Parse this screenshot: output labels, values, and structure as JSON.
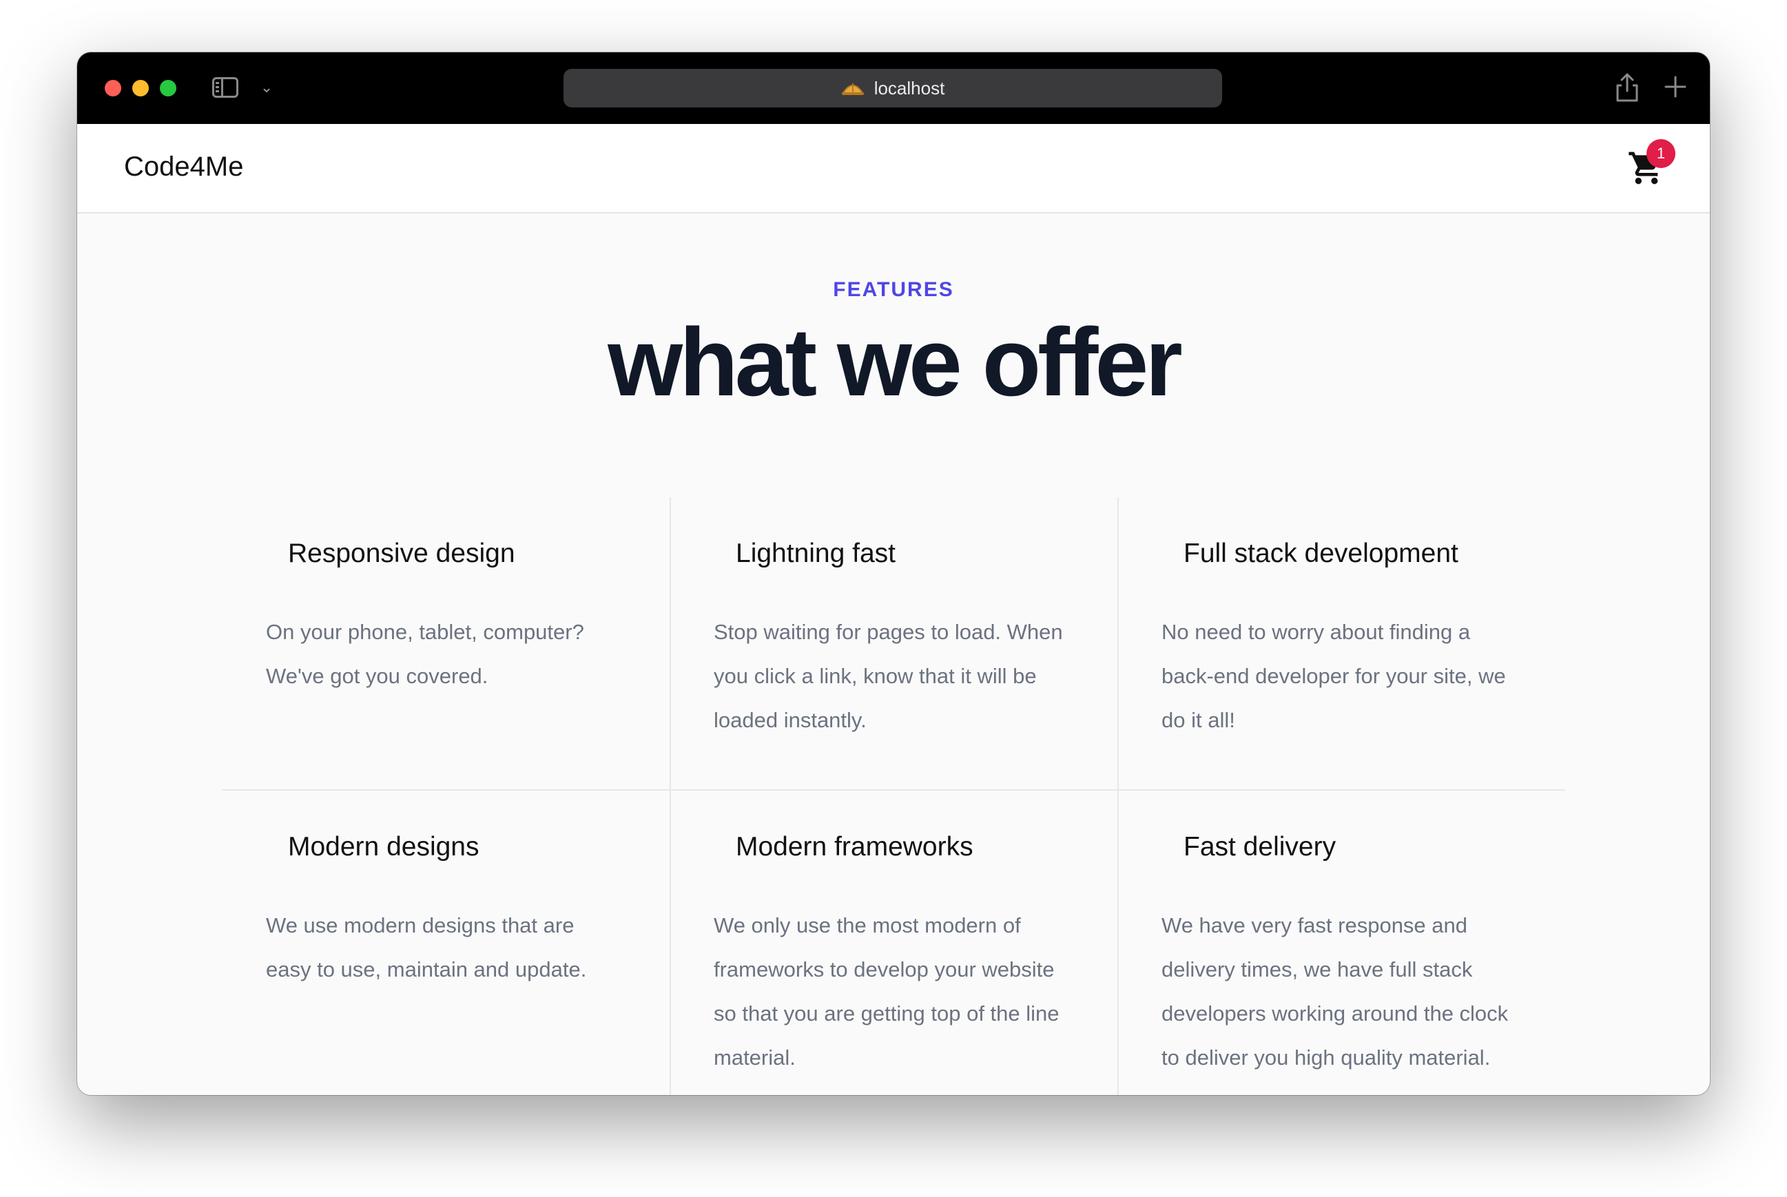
{
  "browser": {
    "url": "localhost"
  },
  "navbar": {
    "brand": "Code4Me",
    "cart_count": "1"
  },
  "hero": {
    "eyebrow": "FEATURES",
    "title": "what we offer"
  },
  "features": [
    {
      "title": "Responsive design",
      "description": "On your phone, tablet, computer? We've got you covered."
    },
    {
      "title": "Lightning fast",
      "description": "Stop waiting for pages to load. When you click a link, know that it will be loaded instantly."
    },
    {
      "title": "Full stack development",
      "description": "No need to worry about finding a back-end developer for your site, we do it all!"
    },
    {
      "title": "Modern designs",
      "description": "We use modern designs that are easy to use, maintain and update."
    },
    {
      "title": "Modern frameworks",
      "description": "We only use the most modern of frameworks to develop your website so that you are getting top of the line material."
    },
    {
      "title": "Fast delivery",
      "description": "We have very fast response and delivery times, we have full stack developers working around the clock to deliver you high quality material."
    }
  ],
  "colors": {
    "accent": "#4f46e5",
    "badge": "#e11d48",
    "heading": "#111827",
    "body_text": "#6b7280"
  }
}
